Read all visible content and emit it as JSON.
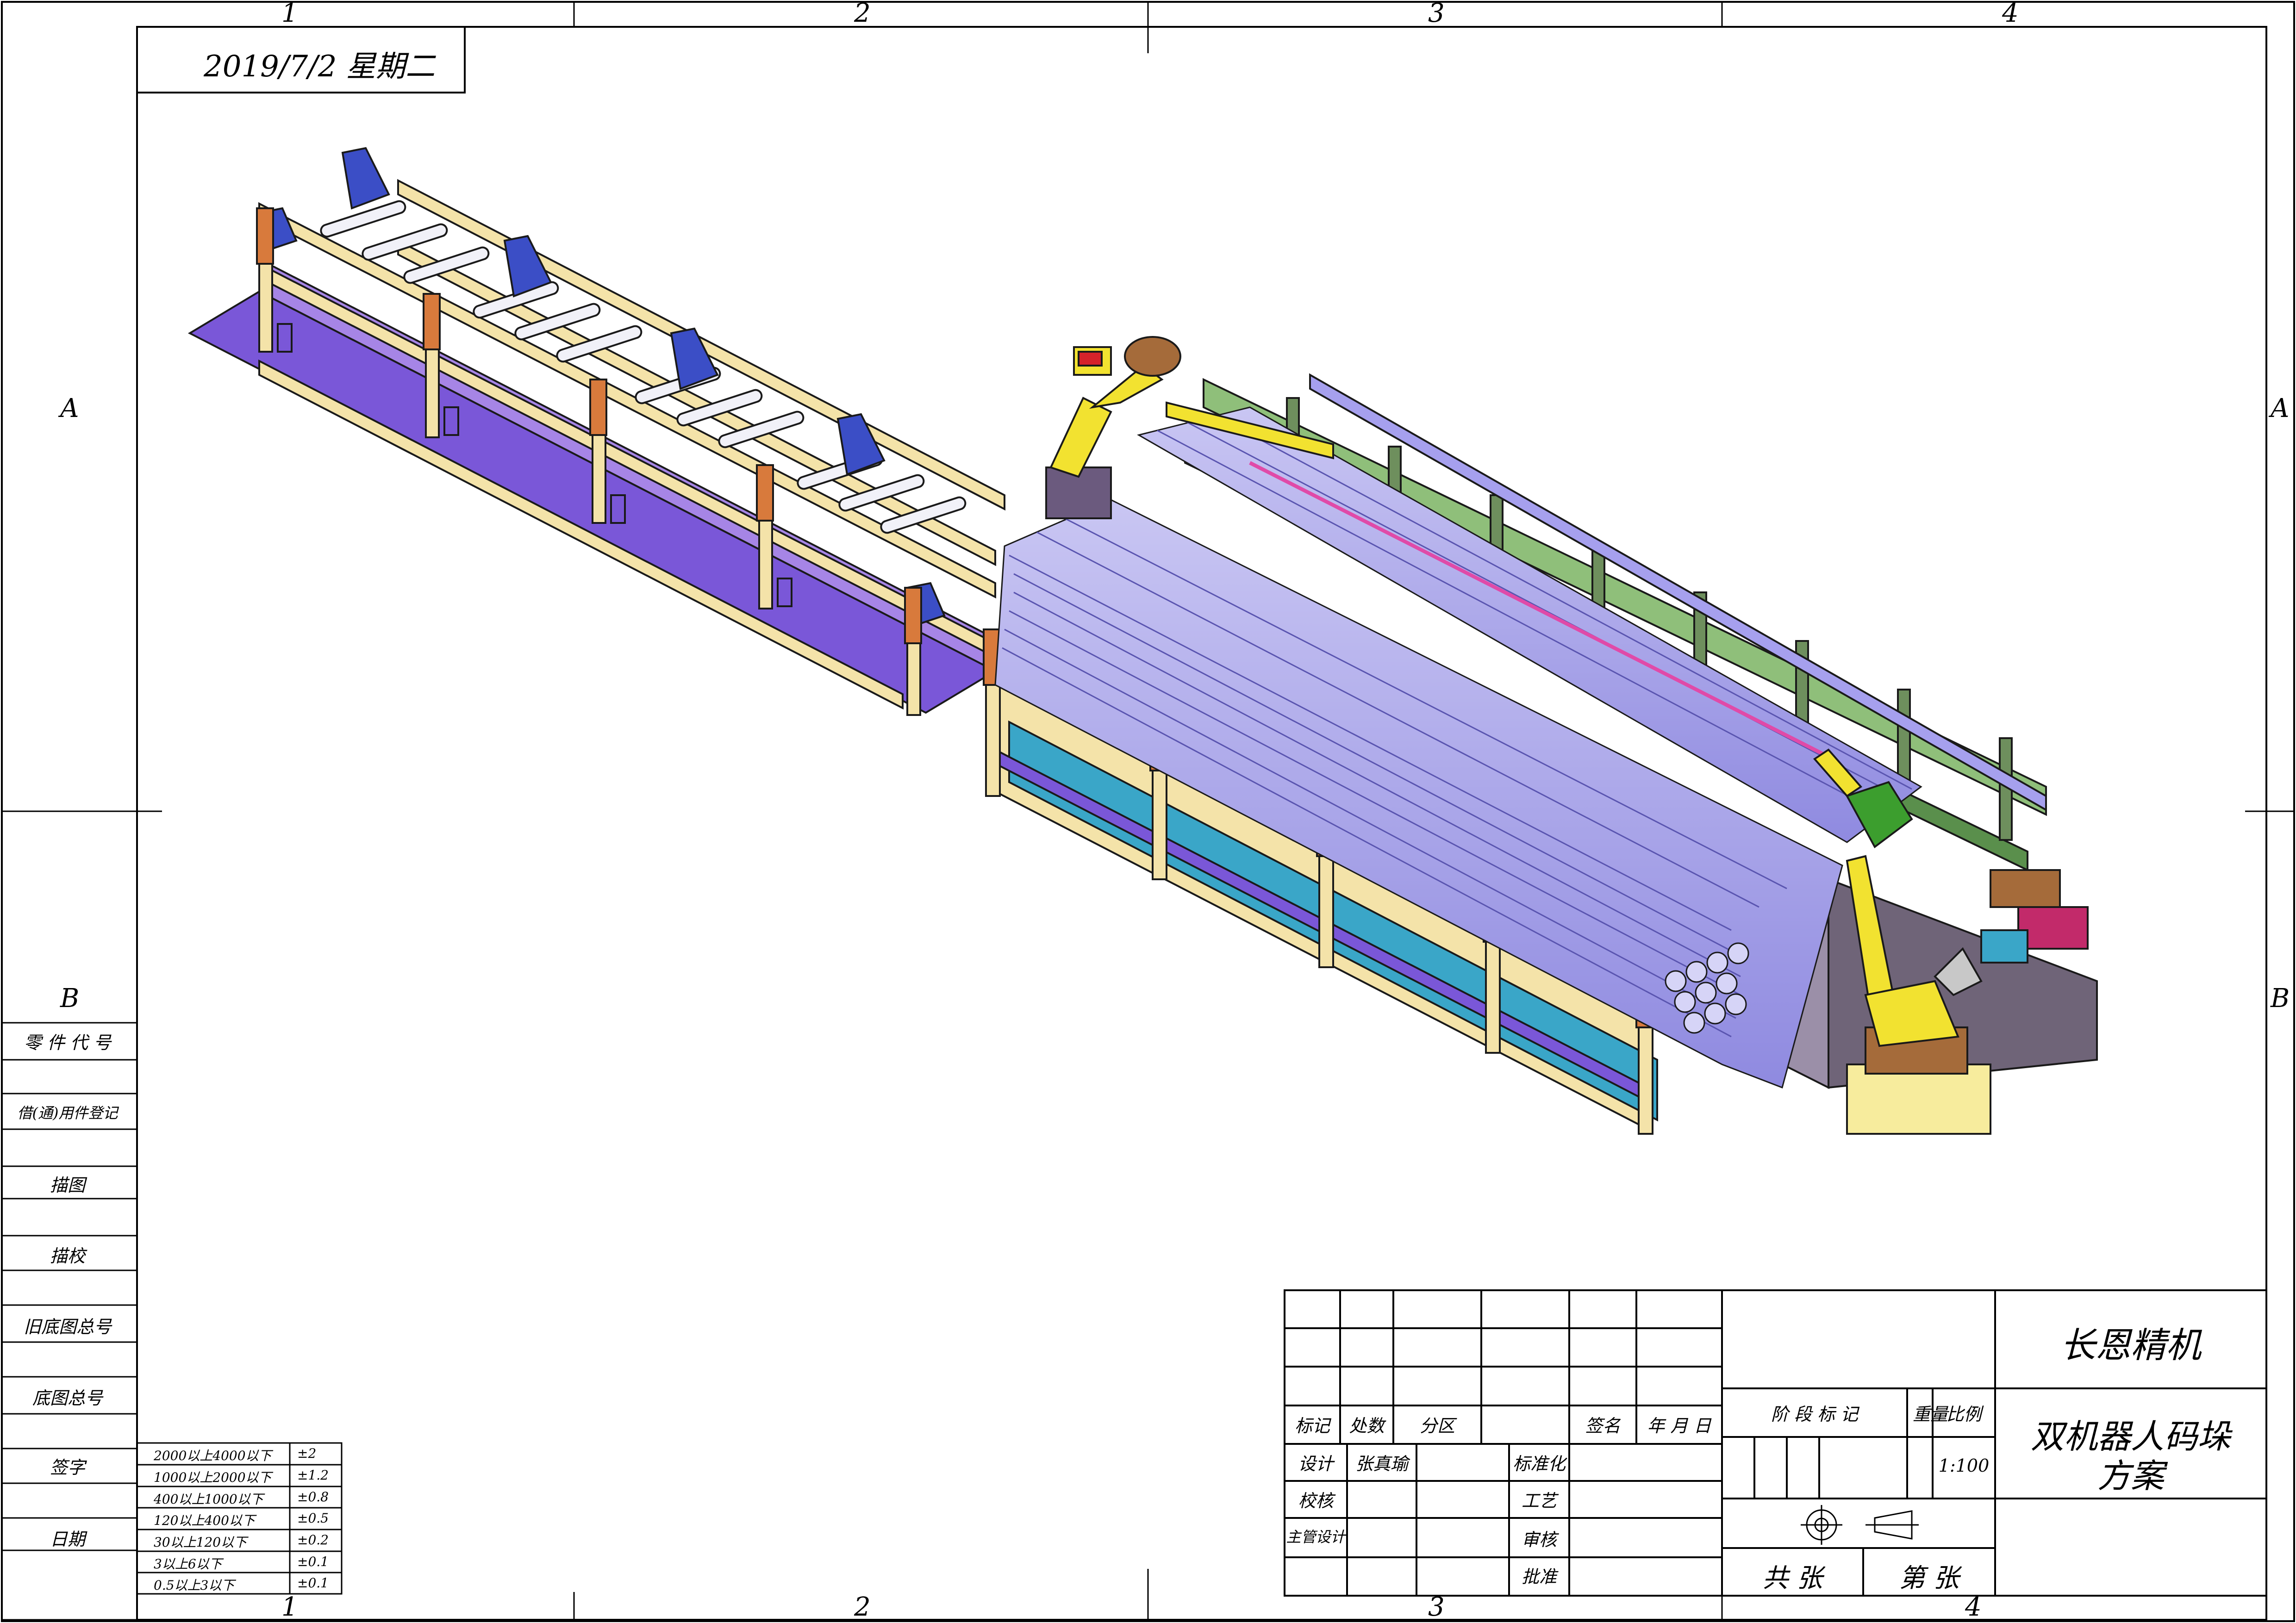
{
  "drawing": {
    "date": "2019/7/2  星期二",
    "zone_columns": [
      "1",
      "2",
      "3",
      "4"
    ],
    "zone_rows": [
      "A",
      "B"
    ]
  },
  "left_column": {
    "cells": [
      "零 件 代 号",
      "借(通)用件登记",
      "描图",
      "描校",
      "旧底图总号",
      "底图总号",
      "签字",
      "日期"
    ]
  },
  "tolerance_table": {
    "rows": [
      {
        "range": "2000以上4000以下",
        "tol": "±2"
      },
      {
        "range": "1000以上2000以下",
        "tol": "±1.2"
      },
      {
        "range": "400以上1000以下",
        "tol": "±0.8"
      },
      {
        "range": "120以上400以下",
        "tol": "±0.5"
      },
      {
        "range": "30以上120以下",
        "tol": "±0.2"
      },
      {
        "range": "3以上6以下",
        "tol": "±0.1"
      },
      {
        "range": "0.5以上3以下",
        "tol": "±0.1"
      }
    ]
  },
  "title_block": {
    "company": "长恩精机",
    "title_line1": "双机器人码垛",
    "title_line2": "方案",
    "mark": "标记",
    "count": "处数",
    "zone": "分区",
    "sign": "签名",
    "date": "年 月 日",
    "design": "设计",
    "designer": "张真瑜",
    "standard": "标准化",
    "check": "校核",
    "process": "工艺",
    "chief": "主管设计",
    "review": "审核",
    "approve": "批准",
    "stage_mark": "阶 段 标 记",
    "weight": "重量",
    "scale_label": "比例",
    "scale": "1:100",
    "total_sheets": "共    张",
    "sheet_no": "第    张"
  }
}
